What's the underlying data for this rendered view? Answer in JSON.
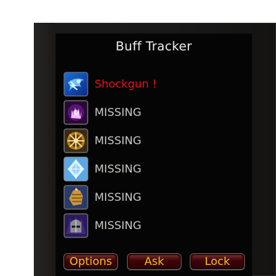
{
  "addon": {
    "title": "Buff Tracker"
  },
  "buffs": [
    {
      "icon": "shockgun-buff-icon",
      "label": "Shockgun !",
      "status": "active",
      "color": "#e1121a"
    },
    {
      "icon": "purple-paw-buff-icon",
      "label": "MISSING",
      "status": "missing",
      "color": "#c9c9c4"
    },
    {
      "icon": "golden-sigil-buff-icon",
      "label": "MISSING",
      "status": "missing",
      "color": "#c9c9c4"
    },
    {
      "icon": "ice-crystal-buff-icon",
      "label": "MISSING",
      "status": "missing",
      "color": "#c9c9c4"
    },
    {
      "icon": "golden-fist-buff-icon",
      "label": "MISSING",
      "status": "missing",
      "color": "#c9c9c4"
    },
    {
      "icon": "knight-helm-buff-icon",
      "label": "MISSING",
      "status": "missing",
      "color": "#c9c9c4"
    }
  ],
  "buttons": {
    "options": "Options",
    "ask": "Ask",
    "lock": "Lock"
  },
  "colors": {
    "button_text": "#f3c21b",
    "button_fill": "#4a0608",
    "panel": "#050505",
    "frame": "#1b1a18"
  }
}
